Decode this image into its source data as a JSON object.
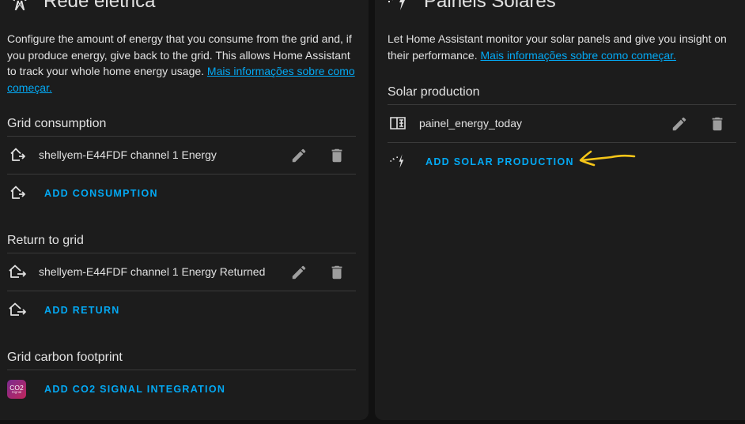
{
  "grid": {
    "title": "Rede elétrica",
    "icon": "transmission-tower-icon",
    "description": "Configure the amount of energy that you consume from the grid and, if you produce energy, give back to the grid. This allows Home Assistant to track your whole home energy usage.",
    "link_text": "Mais informações sobre como começar.",
    "consumption": {
      "heading": "Grid consumption",
      "items": [
        {
          "label": "shellyem-E44FDF channel 1 Energy",
          "icon": "home-import-icon"
        }
      ],
      "add_label": "ADD CONSUMPTION"
    },
    "return": {
      "heading": "Return to grid",
      "items": [
        {
          "label": "shellyem-E44FDF channel 1 Energy Returned",
          "icon": "home-export-icon"
        }
      ],
      "add_label": "ADD RETURN"
    },
    "carbon": {
      "heading": "Grid carbon footprint",
      "logo_text": "CO2",
      "logo_subtext": "Signal",
      "add_label": "ADD CO2 SIGNAL INTEGRATION"
    }
  },
  "solar": {
    "title": "Painéis Solares",
    "icon": "solar-power-icon",
    "description": "Let Home Assistant monitor your solar panels and give you insight on their performance.",
    "link_text": "Mais informações sobre como começar.",
    "production": {
      "heading": "Solar production",
      "items": [
        {
          "label": "painel_energy_today",
          "icon": "solar-panel-icon"
        }
      ],
      "add_label": "ADD SOLAR PRODUCTION"
    }
  },
  "icons": {
    "edit": "pencil-icon",
    "delete": "trash-icon"
  },
  "annotation": {
    "color": "#f5c518"
  },
  "colors": {
    "background": "#111111",
    "card": "#1c1c1c",
    "text": "#e1e1e1",
    "accent": "#03a9f4",
    "icon_muted": "#9e9e9e"
  }
}
